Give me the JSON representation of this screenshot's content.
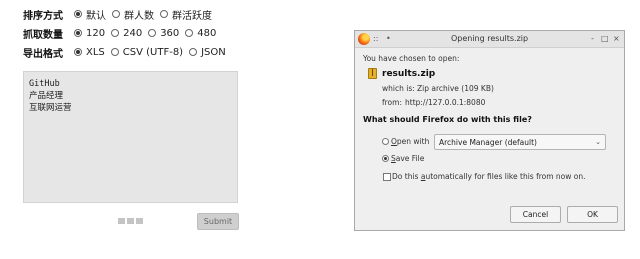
{
  "form": {
    "sort": {
      "label": "排序方式",
      "options": [
        {
          "label": "默认",
          "selected": true
        },
        {
          "label": "群人数",
          "selected": false
        },
        {
          "label": "群活跃度",
          "selected": false
        }
      ]
    },
    "count": {
      "label": "抓取数量",
      "options": [
        {
          "label": "120",
          "selected": true
        },
        {
          "label": "240",
          "selected": false
        },
        {
          "label": "360",
          "selected": false
        },
        {
          "label": "480",
          "selected": false
        }
      ]
    },
    "format": {
      "label": "导出格式",
      "options": [
        {
          "label": "XLS",
          "selected": true
        },
        {
          "label": "CSV (UTF-8)",
          "selected": false
        },
        {
          "label": "JSON",
          "selected": false
        }
      ]
    },
    "keywords": [
      "GitHub",
      "产品经理",
      "互联网运营"
    ],
    "submit_label": "Submit"
  },
  "dialog": {
    "title": "Opening results.zip",
    "window_controls": {
      "pin": "::",
      "menu": "•",
      "minimize": "-",
      "maximize": "□",
      "close": "×"
    },
    "intro": "You have chosen to open:",
    "filename": "results.zip",
    "which_is_label": "which is:",
    "which_is_value": "Zip archive (109 KB)",
    "from_label": "from:",
    "from_value": "http://127.0.0.1:8080",
    "question": "What should Firefox do with this file?",
    "open_with_prefix": "O",
    "open_with_rest": "pen with",
    "open_with_app": "Archive Manager (default)",
    "save_file_prefix": "S",
    "save_file_rest": "ave File",
    "auto_prefix": "Do this ",
    "auto_underlined": "a",
    "auto_rest": "utomatically for files like this from now on.",
    "action": "save",
    "auto_checked": false,
    "cancel_label": "Cancel",
    "ok_label": "OK"
  }
}
